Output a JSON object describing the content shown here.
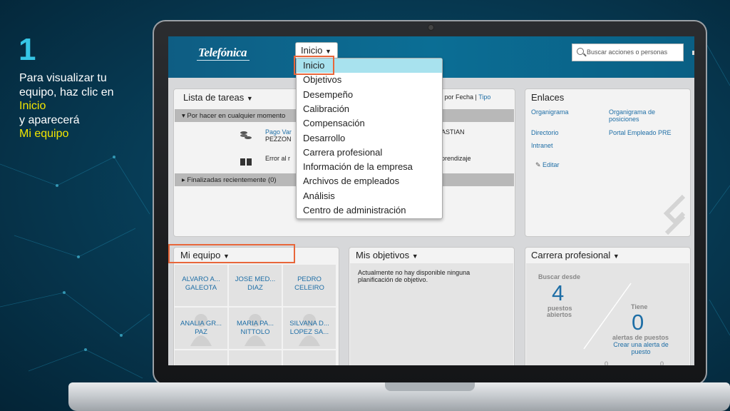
{
  "caption": {
    "number": "1",
    "line1": "Para visualizar tu",
    "line2": "equipo, haz clic en",
    "highlight1": "Inicio",
    "line3": "y aparecerá",
    "highlight2": "Mi equipo"
  },
  "header": {
    "logo": "Telefónica",
    "home_button": "Inicio",
    "search_placeholder": "Buscar acciones o personas"
  },
  "menu": {
    "items": [
      "Inicio",
      "Objetivos",
      "Desempeño",
      "Calibración",
      "Compensación",
      "Desarrollo",
      "Carrera profesional",
      "Información de la empresa",
      "Archivos de empleados",
      "Análisis",
      "Centro de administración"
    ],
    "active": "Inicio"
  },
  "tasks": {
    "title": "Lista de tareas",
    "sort_label": "r por Fecha |",
    "sort_type": "Tipo",
    "section_pending": "Por hacer en cualquier momento",
    "row1_link": "Pago Var",
    "row1_name": "PEZZON",
    "row1_right": "ASTIAN",
    "row2_text": "Error al r",
    "row2_right": "prendizaje",
    "section_done": "Finalizadas recientemente (0)"
  },
  "links": {
    "title": "Enlaces",
    "items": [
      "Organigrama",
      "Organigrama de posiciones",
      "Directorio",
      "Portal Empleado PRE",
      "Intranet"
    ],
    "edit": "Editar"
  },
  "team": {
    "title": "Mi equipo",
    "members": [
      {
        "line1": "ALVARO A...",
        "line2": "GALEOTA"
      },
      {
        "line1": "JOSE MED...",
        "line2": "DIAZ"
      },
      {
        "line1": "PEDRO",
        "line2": "CELEIRO"
      },
      {
        "line1": "ANALIA GR...",
        "line2": "PAZ"
      },
      {
        "line1": "MARIA PA...",
        "line2": "NITTOLO"
      },
      {
        "line1": "SILVANA D...",
        "line2": "LOPEZ SA..."
      }
    ]
  },
  "objectives": {
    "title": "Mis objetivos",
    "empty_line1": "Actualmente no hay disponible ninguna",
    "empty_line2": "planificación de objetivo."
  },
  "career": {
    "title": "Carrera profesional",
    "left_label": "Buscar desde",
    "left_value": "4",
    "left_unit1": "puestos",
    "left_unit2": "abiertos",
    "right_label": "Tiene",
    "right_value": "0",
    "right_unit": "alertas de puestos",
    "create_alert1": "Crear una alerta de",
    "create_alert2": "puesto",
    "bottom_left": "0",
    "bottom_right": "0"
  },
  "colors": {
    "accent": "#36c6e6",
    "highlight": "#f3e600",
    "box": "#e8663a",
    "link": "#1e6ea6"
  }
}
